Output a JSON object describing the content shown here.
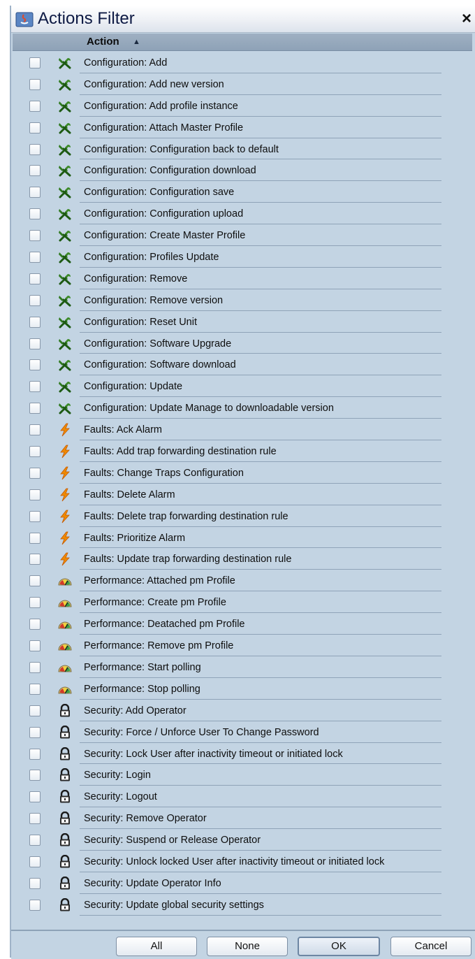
{
  "window": {
    "title": "Actions Filter",
    "close_label": "×"
  },
  "table": {
    "column_header": "Action",
    "sort_indicator": "▲"
  },
  "actions": [
    {
      "category": "config",
      "label": "Configuration: Add"
    },
    {
      "category": "config",
      "label": "Configuration: Add new version"
    },
    {
      "category": "config",
      "label": "Configuration: Add profile instance"
    },
    {
      "category": "config",
      "label": "Configuration: Attach Master Profile"
    },
    {
      "category": "config",
      "label": "Configuration: Configuration back to default"
    },
    {
      "category": "config",
      "label": "Configuration: Configuration download"
    },
    {
      "category": "config",
      "label": "Configuration: Configuration save"
    },
    {
      "category": "config",
      "label": "Configuration: Configuration upload"
    },
    {
      "category": "config",
      "label": "Configuration: Create Master Profile"
    },
    {
      "category": "config",
      "label": "Configuration: Profiles Update"
    },
    {
      "category": "config",
      "label": "Configuration: Remove"
    },
    {
      "category": "config",
      "label": "Configuration: Remove version"
    },
    {
      "category": "config",
      "label": "Configuration: Reset Unit"
    },
    {
      "category": "config",
      "label": "Configuration: Software Upgrade"
    },
    {
      "category": "config",
      "label": "Configuration: Software download"
    },
    {
      "category": "config",
      "label": "Configuration: Update"
    },
    {
      "category": "config",
      "label": "Configuration: Update Manage to downloadable version"
    },
    {
      "category": "faults",
      "label": "Faults: Ack Alarm"
    },
    {
      "category": "faults",
      "label": "Faults: Add trap forwarding destination rule"
    },
    {
      "category": "faults",
      "label": "Faults: Change Traps Configuration"
    },
    {
      "category": "faults",
      "label": "Faults: Delete Alarm"
    },
    {
      "category": "faults",
      "label": "Faults: Delete trap forwarding destination rule"
    },
    {
      "category": "faults",
      "label": "Faults: Prioritize Alarm"
    },
    {
      "category": "faults",
      "label": "Faults: Update trap forwarding destination rule"
    },
    {
      "category": "performance",
      "label": "Performance: Attached pm Profile"
    },
    {
      "category": "performance",
      "label": "Performance: Create pm Profile"
    },
    {
      "category": "performance",
      "label": "Performance: Deatached pm Profile"
    },
    {
      "category": "performance",
      "label": "Performance: Remove pm Profile"
    },
    {
      "category": "performance",
      "label": "Performance: Start polling"
    },
    {
      "category": "performance",
      "label": "Performance: Stop polling"
    },
    {
      "category": "security",
      "label": "Security: Add Operator"
    },
    {
      "category": "security",
      "label": "Security: Force / Unforce User To Change Password"
    },
    {
      "category": "security",
      "label": "Security: Lock User after inactivity timeout or initiated lock"
    },
    {
      "category": "security",
      "label": "Security: Login"
    },
    {
      "category": "security",
      "label": "Security: Logout"
    },
    {
      "category": "security",
      "label": "Security: Remove Operator"
    },
    {
      "category": "security",
      "label": "Security: Suspend or Release Operator"
    },
    {
      "category": "security",
      "label": "Security: Unlock locked User after inactivity timeout or initiated lock"
    },
    {
      "category": "security",
      "label": "Security: Update Operator Info"
    },
    {
      "category": "security",
      "label": "Security: Update global security settings"
    }
  ],
  "icons": {
    "config": "wrench-screwdriver-icon",
    "faults": "lightning-bolt-icon",
    "performance": "gauge-icon",
    "security": "padlock-icon"
  },
  "buttons": {
    "all": "All",
    "none": "None",
    "ok": "OK",
    "cancel": "Cancel"
  },
  "colors": {
    "background": "#c3d4e3",
    "header": "#8ea2b7",
    "config_icon": "#2f7a1f",
    "faults_icon": "#f08a00"
  }
}
